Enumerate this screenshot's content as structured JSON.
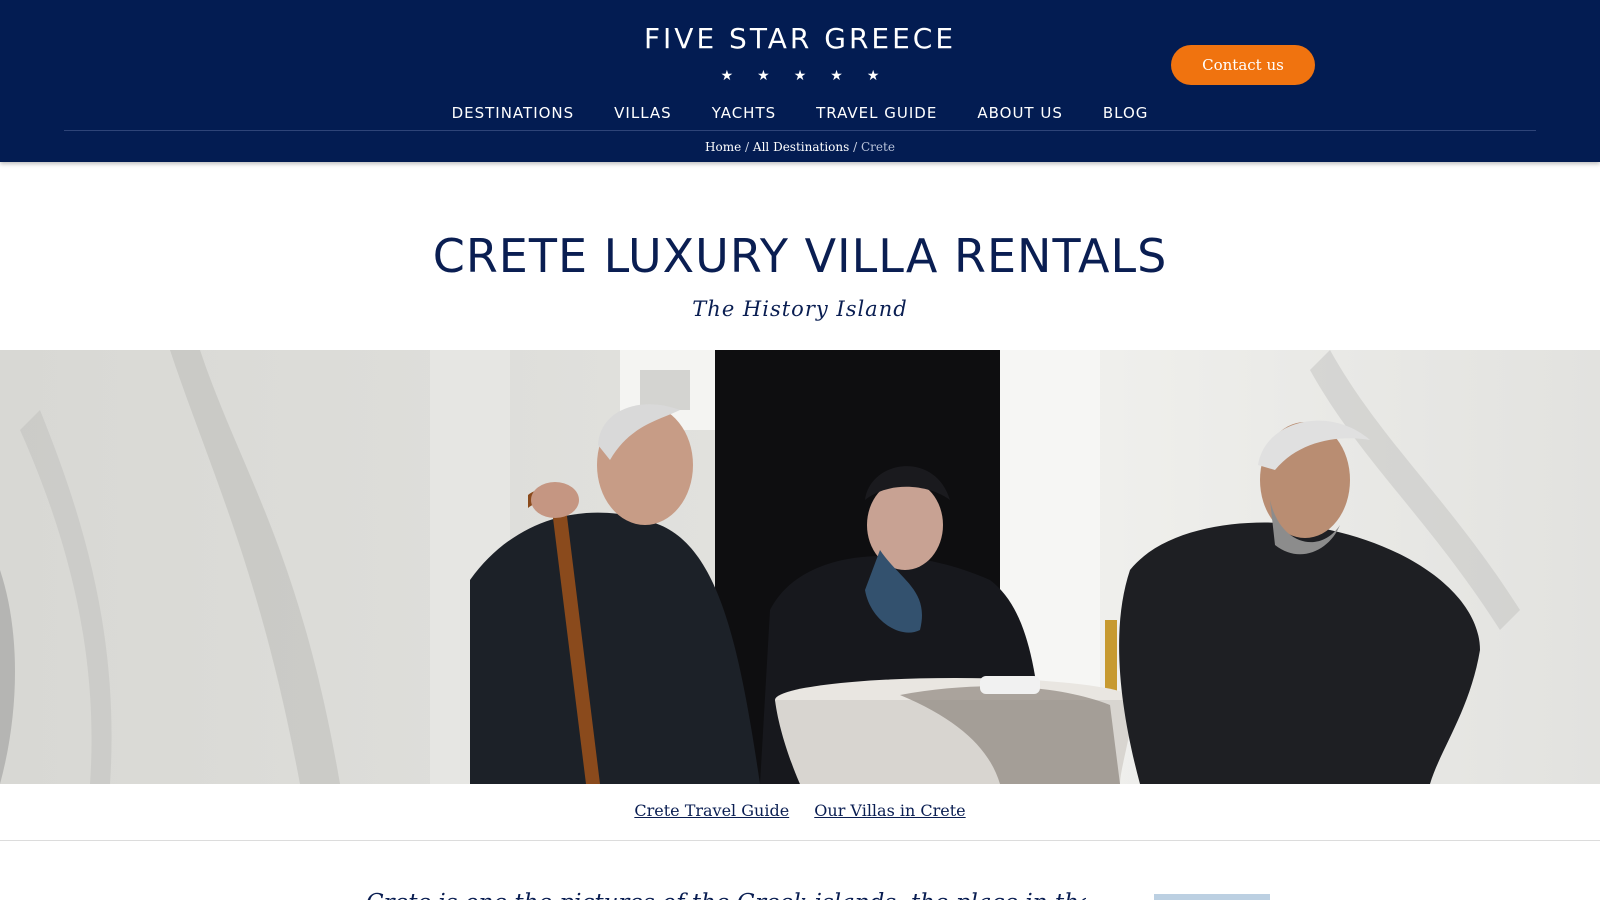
{
  "header": {
    "logo_text": "FIVE STAR GREECE",
    "logo_stars": [
      "★",
      "★",
      "★",
      "★",
      "★"
    ],
    "contact_label": "Contact us"
  },
  "nav": {
    "items": [
      {
        "label": "DESTINATIONS"
      },
      {
        "label": "VILLAS"
      },
      {
        "label": "YACHTS"
      },
      {
        "label": "TRAVEL GUIDE"
      },
      {
        "label": "ABOUT US"
      },
      {
        "label": "BLOG"
      }
    ]
  },
  "breadcrumb": {
    "home": "Home",
    "separator": "/",
    "all_destinations": "All Destinations",
    "current": "Crete"
  },
  "main": {
    "title": "CRETE LUXURY VILLA RENTALS",
    "subtitle": "The History Island",
    "hero_alt": "Three elderly locals seated at a small table in front of a whitewashed wall",
    "links": {
      "travel_guide": "Crete Travel Guide",
      "villas": "Our Villas in Crete"
    },
    "intro_text": "Crete is one the pictures of the Greek islands, the place in the"
  },
  "colors": {
    "header_bg": "#031c52",
    "accent": "#f0730f",
    "title_text": "#0a1e52"
  }
}
